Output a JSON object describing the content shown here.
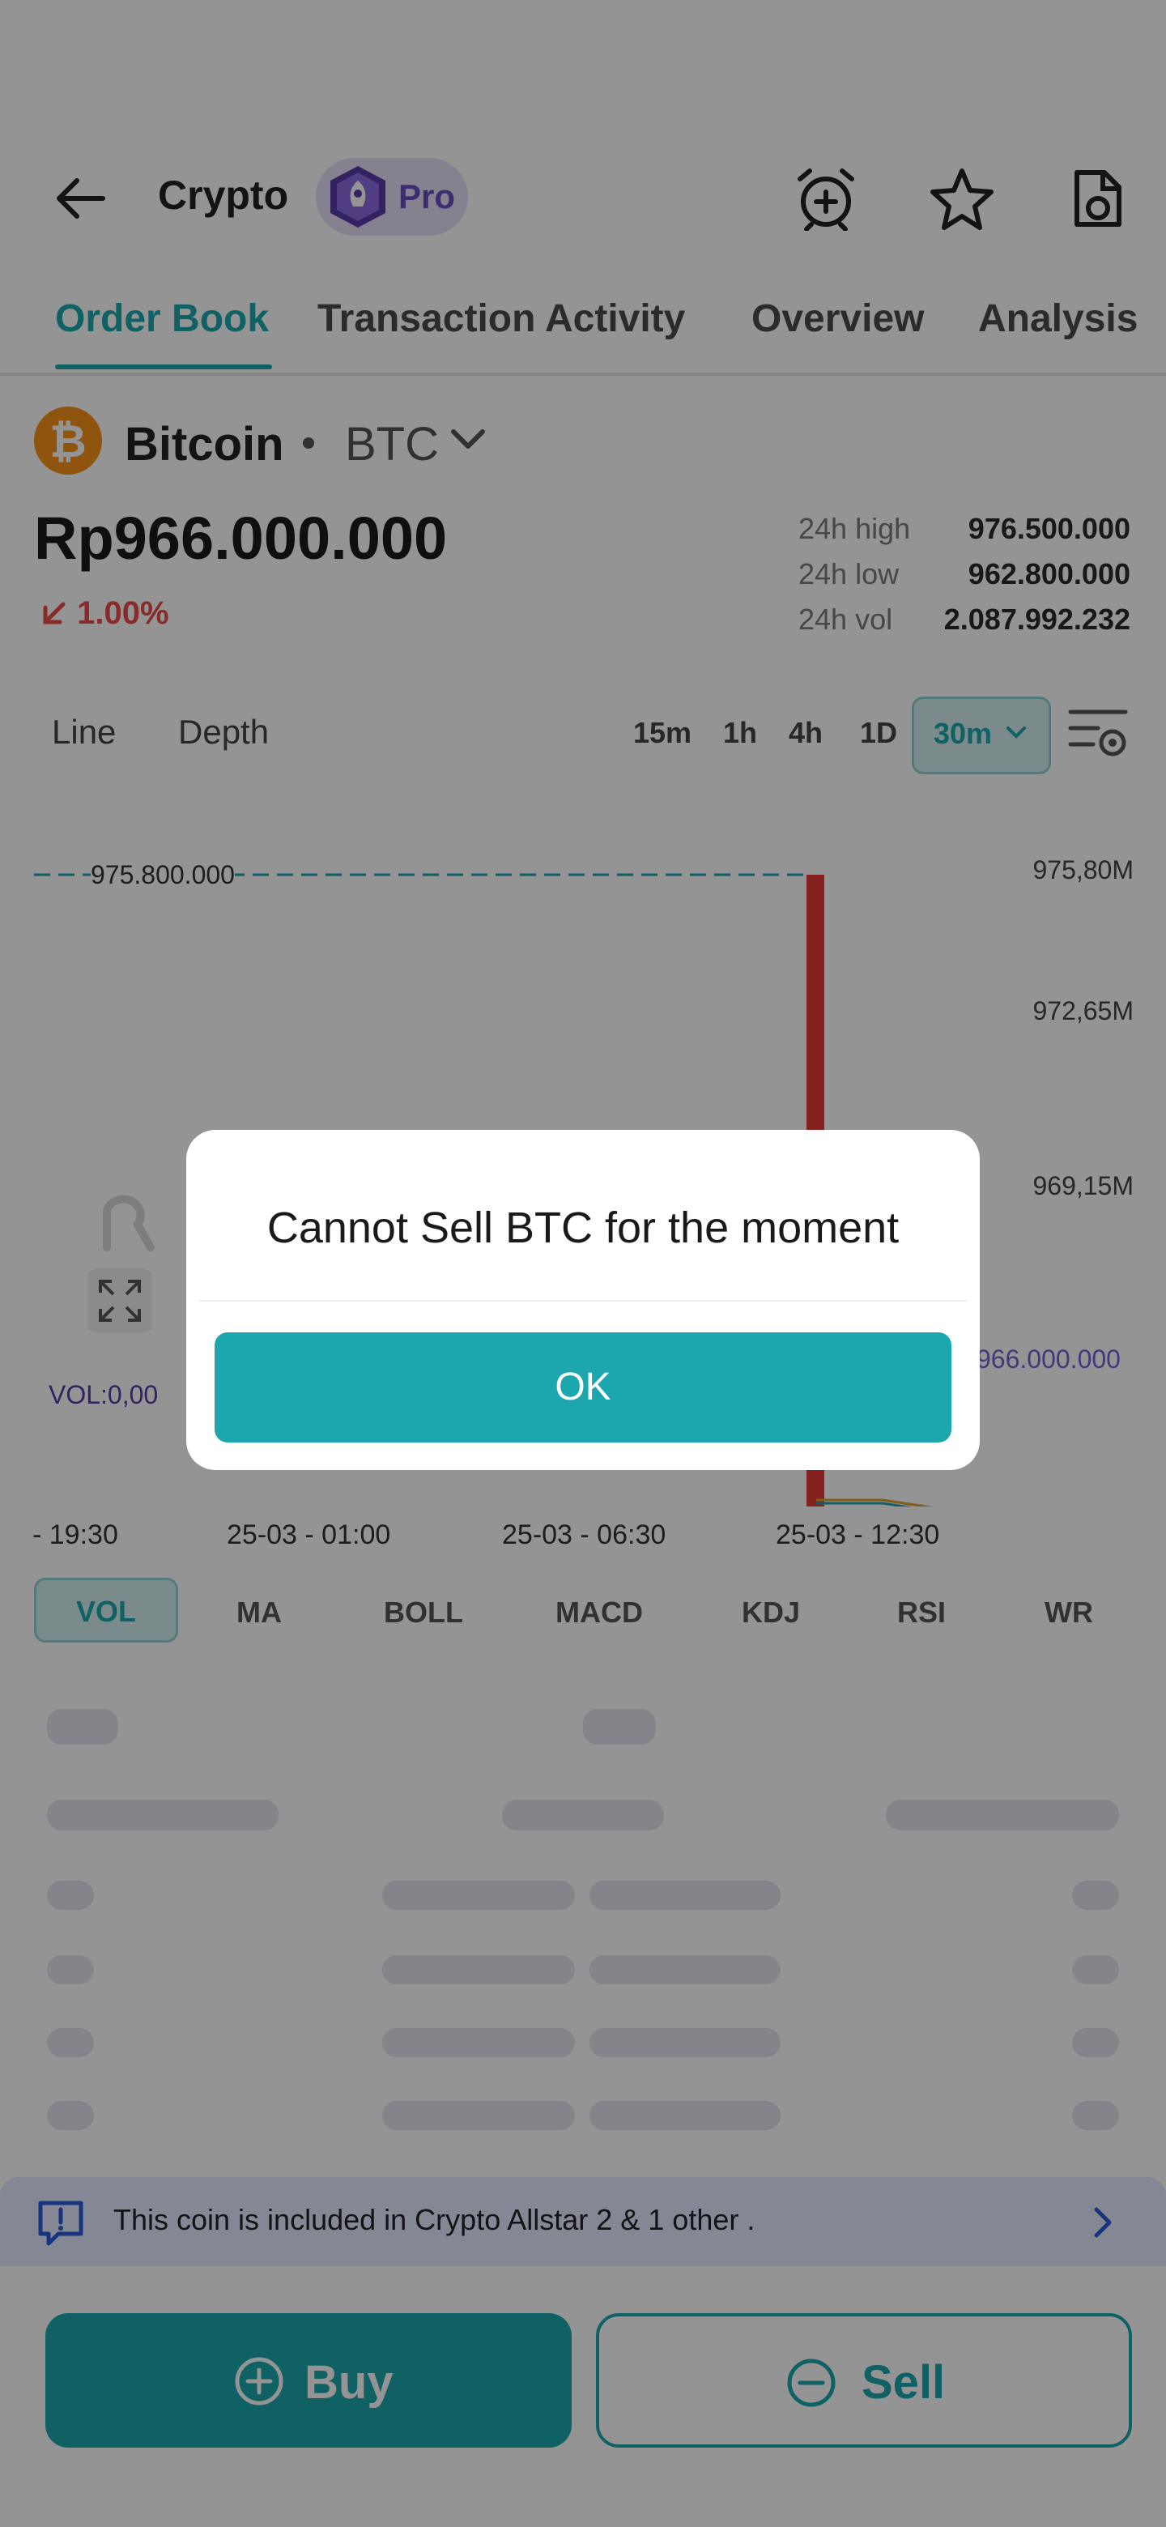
{
  "header": {
    "title": "Crypto",
    "pro_label": "Pro"
  },
  "tabs": [
    {
      "label": "Order Book",
      "active": true
    },
    {
      "label": "Transaction Activity",
      "active": false
    },
    {
      "label": "Overview",
      "active": false
    },
    {
      "label": "Analysis",
      "active": false
    }
  ],
  "coin": {
    "logo_glyph": "₿",
    "name": "Bitcoin",
    "symbol": "BTC",
    "price": "Rp966.000.000",
    "change": "1.00%",
    "change_direction": "down",
    "stats": [
      {
        "label": "24h high",
        "value": "976.500.000"
      },
      {
        "label": "24h low",
        "value": "962.800.000"
      },
      {
        "label": "24h vol",
        "value": "2.087.992.232"
      }
    ]
  },
  "chart_controls": {
    "modes": [
      "Line",
      "Depth"
    ],
    "timeframes": [
      "15m",
      "1h",
      "4h",
      "1D"
    ],
    "selected_timeframe": "30m"
  },
  "chart_data": {
    "type": "candlestick",
    "y_tick_labels": [
      "975,80M",
      "972,65M",
      "969,15M"
    ],
    "x_tick_labels": [
      "- 19:30",
      "25-03 - 01:00",
      "25-03 - 06:30",
      "25-03 - 12:30"
    ],
    "high_marker_label": "975.800.000",
    "current_price_label": "966.000.000",
    "volume_label": "VOL:0,00",
    "candles": [
      {
        "time": "25-03 - 12:30",
        "open": 975.8,
        "close": 962.8,
        "unit": "M",
        "direction": "down"
      }
    ],
    "colors": {
      "down": "#e53935",
      "marker_line": "#1ba7ad",
      "current_price": "#7a5fd1"
    }
  },
  "indicators": {
    "items": [
      "VOL",
      "MA",
      "BOLL",
      "MACD",
      "KDJ",
      "RSI",
      "WR"
    ],
    "selected": "VOL"
  },
  "banner": {
    "text": "This coin is included in  Crypto Allstar 2  & 1 other ."
  },
  "actions": {
    "buy_label": "Buy",
    "sell_label": "Sell"
  },
  "dialog": {
    "message": "Cannot Sell BTC for the moment",
    "ok_label": "OK"
  },
  "colors": {
    "accent": "#1ba7ad",
    "negative": "#e84a4a",
    "pro": "#6a4cc0"
  }
}
